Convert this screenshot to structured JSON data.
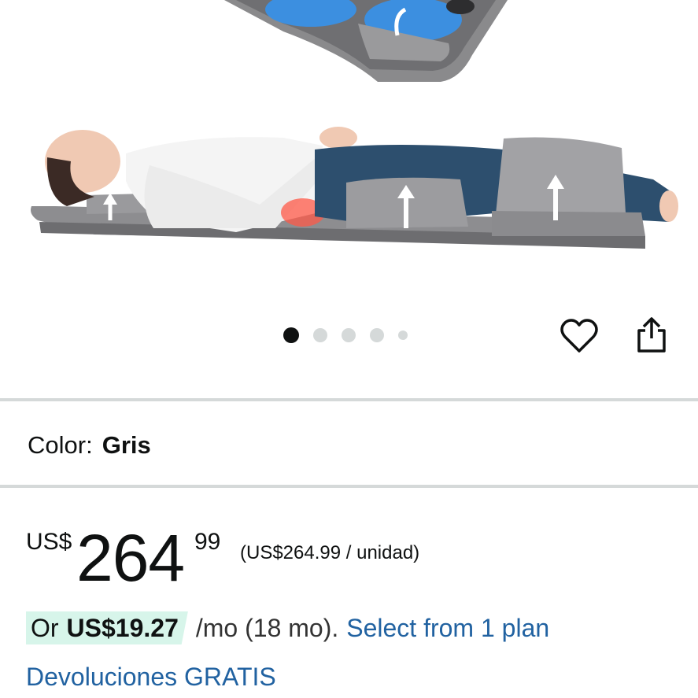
{
  "product_image": {
    "description_icon": "massage-mat-image",
    "carousel": {
      "count": 5,
      "active_index": 0
    }
  },
  "actions": {
    "favorite_icon": "heart-outline-icon",
    "share_icon": "share-icon"
  },
  "color_selector": {
    "label": "Color:",
    "value": "Gris"
  },
  "price": {
    "currency": "US$",
    "whole": "264",
    "fraction": "99",
    "unit_price": "(US$264.99 / unidad)"
  },
  "installment": {
    "prefix": "Or",
    "amount": "US$19.27",
    "term": "/mo (18 mo).",
    "link": "Select from 1 plan"
  },
  "returns": {
    "label": "Devoluciones GRATIS"
  },
  "colors": {
    "link": "#2162a1",
    "badge_bg": "#d7f5ea",
    "divider": "#d5d9d9",
    "text": "#0f1111"
  }
}
